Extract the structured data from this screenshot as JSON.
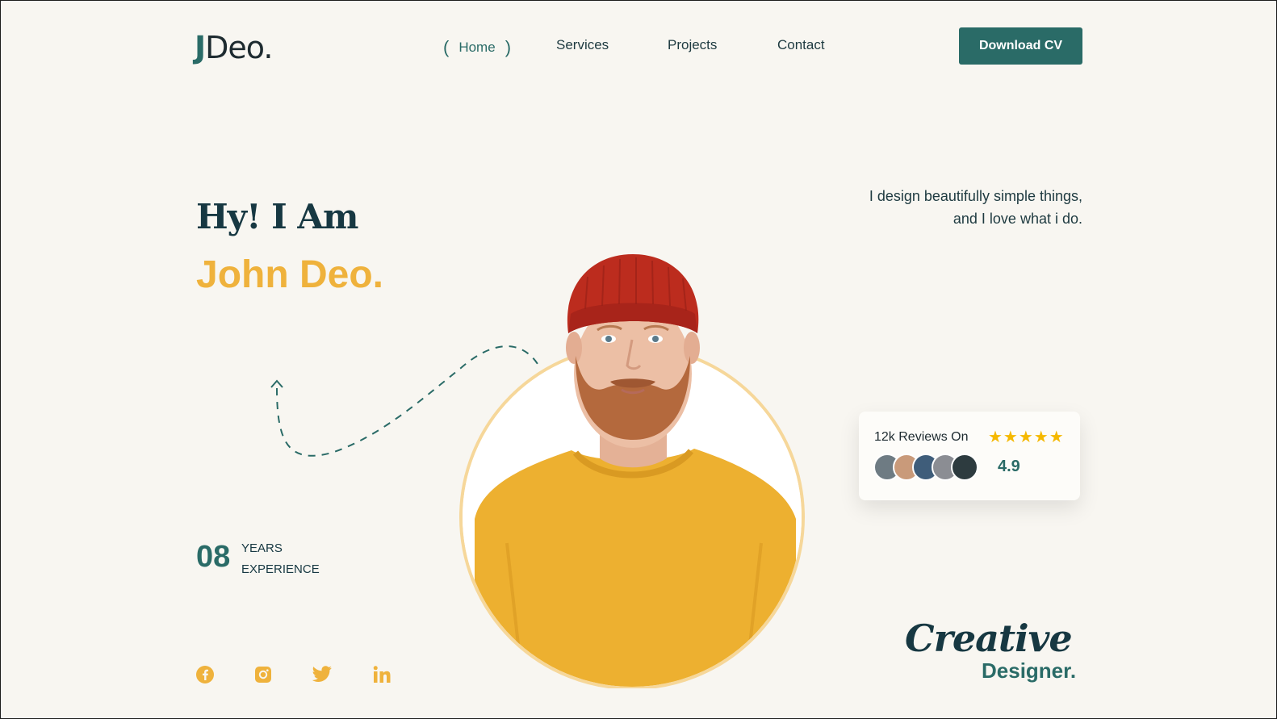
{
  "header": {
    "logo_initial": "J",
    "logo_rest": "Deo.",
    "nav": {
      "home_open": "(",
      "home": "Home",
      "home_close": ")",
      "services": "Services",
      "projects": "Projects",
      "contact": "Contact"
    },
    "download_label": "Download CV"
  },
  "hero": {
    "greeting": "Hy! I Am",
    "name": "John Deo.",
    "tagline_line1": "I design beautifully simple things,",
    "tagline_line2": "and I love what i do.",
    "experience_number": "08",
    "experience_line1": "YEARS",
    "experience_line2": "EXPERIENCE"
  },
  "reviews": {
    "title": "12k Reviews On",
    "stars": "★★★★★",
    "rating": "4.9",
    "star_count": 5
  },
  "footer_tag": {
    "creative": "Creative",
    "designer": "Designer."
  },
  "social": [
    "facebook-icon",
    "instagram-icon",
    "twitter-icon",
    "linkedin-icon"
  ],
  "colors": {
    "accent": "#2a6b67",
    "highlight": "#efb23c",
    "background": "#f8f6f1",
    "text_dark": "#173842"
  }
}
